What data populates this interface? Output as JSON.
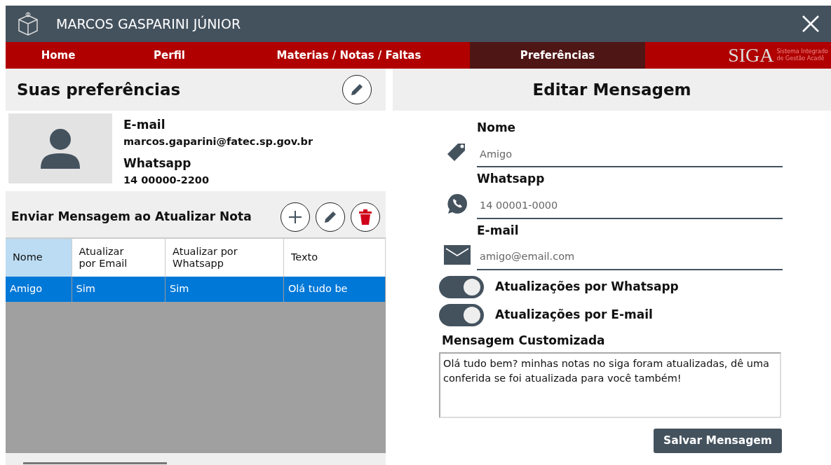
{
  "window": {
    "title": "MARCOS GASPARINI JÚNIOR"
  },
  "nav": [
    {
      "label": "Home",
      "selected": false
    },
    {
      "label": "Perfil",
      "selected": false
    },
    {
      "label": "Materias / Notas / Faltas",
      "selected": false
    },
    {
      "label": "Preferências",
      "selected": true
    }
  ],
  "logo": {
    "mark": "SIGA",
    "tagline": [
      "Sistema Integrado",
      "de Gestão Acadê"
    ]
  },
  "preferences": {
    "title": "Suas preferências",
    "profile": {
      "email_label": "E-mail",
      "email": "marcos.gaparini@fatec.sp.gov.br",
      "whatsapp_label": "Whatsapp",
      "whatsapp": "14 00000-2200"
    }
  },
  "messages": {
    "title": "Enviar Mensagem ao Atualizar Nota",
    "table": {
      "columns": [
        {
          "label": "Nome",
          "selected": true
        },
        {
          "label": "Atualizar\npor Email",
          "selected": false
        },
        {
          "label": "Atualizar por\nWhatsapp",
          "selected": false
        },
        {
          "label": "Texto",
          "selected": false
        }
      ],
      "rows": [
        {
          "cells": [
            "Amigo",
            "Sim",
            "Sim",
            "Olá tudo be"
          ],
          "selected": true
        }
      ]
    }
  },
  "editor": {
    "title": "Editar Mensagem",
    "fields": [
      {
        "kind": "tag",
        "label": "Nome",
        "value": "Amigo"
      },
      {
        "kind": "whatsapp",
        "label": "Whatsapp",
        "value": "14 00001-0000"
      },
      {
        "kind": "mail",
        "label": "E-mail",
        "value": "amigo@email.com"
      }
    ],
    "toggles": [
      {
        "label": "Atualizações por Whatsapp",
        "on": true
      },
      {
        "label": "Atualizações por E-mail",
        "on": true
      }
    ],
    "message_label": "Mensagem Customizada",
    "message": "Olá tudo bem? minhas notas no siga foram atualizadas, dê uma conferida se foi atualizada para você também!",
    "save": "Salvar Mensagem"
  }
}
